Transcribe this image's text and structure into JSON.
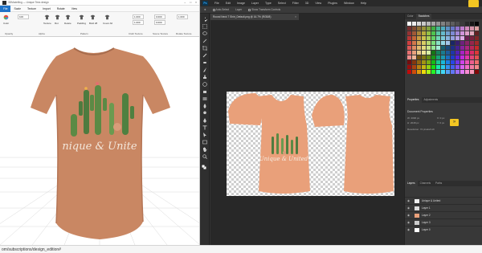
{
  "designer": {
    "title": "3DModelling — Unique Tees design",
    "menu": [
      "File",
      "Scale",
      "Texture",
      "Import",
      "Rotate",
      "View"
    ],
    "ribbon": {
      "quality_label": "Color",
      "zoom": "100",
      "texture_buttons": [
        "Texture",
        "Rot",
        "Delete",
        "Padding",
        "Bold 28",
        "Cover All"
      ],
      "coords": [
        "1.000",
        "1.000",
        "0.000",
        "0.000",
        "1.000"
      ],
      "groups": [
        "Opacity",
        "Alpha",
        "Pattern",
        "Cloth Texture",
        "Scene Texture",
        "Rotate Texture"
      ]
    },
    "tshirt_text": "nique & Unite"
  },
  "photoshop": {
    "menu": [
      "File",
      "Edit",
      "Image",
      "Layer",
      "Type",
      "Select",
      "Filter",
      "3D",
      "View",
      "Plugins",
      "Window",
      "Help"
    ],
    "options": [
      "Auto-Select",
      "Layer",
      "Show Transform Controls"
    ],
    "doc_tab": "Round Neck T Shirt_Default.png @ 16.7% (RGB/8)",
    "canvas_text": "Unique & United",
    "panel_tabs_top": [
      "Color",
      "Swatches"
    ],
    "panel_tabs_props": [
      "Properties",
      "Adjustments"
    ],
    "properties_title": "Document Properties",
    "properties_rows": [
      "W: 4096 px",
      "H: 2048 px",
      "X: 0 px",
      "Y: 0 px",
      "Resolution: 72 pixels/inch"
    ],
    "panel_tabs_layers": [
      "Layers",
      "Channels",
      "Paths"
    ],
    "layers": [
      "Unique & United",
      "Layer 1",
      "Layer 2",
      "Layer 3",
      "Layer 0"
    ],
    "accent": "#f3c622"
  },
  "status_url": "om/subscriptions/design_edition#"
}
